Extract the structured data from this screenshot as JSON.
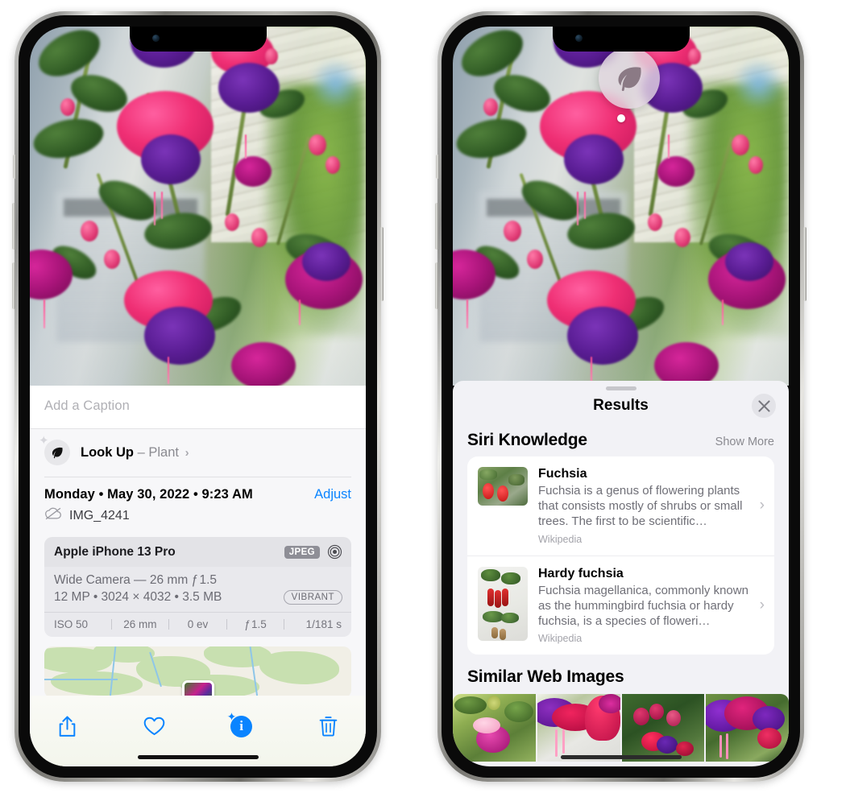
{
  "left_phone": {
    "caption": {
      "placeholder": "Add a Caption",
      "value": ""
    },
    "look_up": {
      "label": "Look Up",
      "dash": "–",
      "subject": "Plant",
      "chevron": "›",
      "icon": "leaf-icon",
      "sparkle": "✦"
    },
    "metadata": {
      "date_line": "Monday • May 30, 2022 • 9:23 AM",
      "adjust_label": "Adjust",
      "filename": "IMG_4241",
      "cloud_icon": "icloud-slash-icon"
    },
    "camera_card": {
      "model": "Apple iPhone 13 Pro",
      "format_chip": "JPEG",
      "raw_icon": "raw-circle-icon",
      "lens_line": "Wide Camera — 26 mm ƒ 1.5",
      "specs_line": "12 MP • 3024 × 4032 • 3.5 MB",
      "style_chip": "VIBRANT",
      "exif": [
        {
          "name": "iso",
          "value": "ISO 50"
        },
        {
          "name": "focal-length",
          "value": "26 mm"
        },
        {
          "name": "exposure-bias",
          "value": "0 ev"
        },
        {
          "name": "aperture",
          "value": "ƒ 1.5"
        },
        {
          "name": "shutter-speed",
          "value": "1/181 s"
        }
      ]
    },
    "toolbar": [
      {
        "name": "share-button",
        "icon": "share-icon"
      },
      {
        "name": "favorite-button",
        "icon": "heart-icon"
      },
      {
        "name": "info-button",
        "icon": "info-sparkle-icon",
        "glyph": "i"
      },
      {
        "name": "delete-button",
        "icon": "trash-icon"
      }
    ]
  },
  "right_phone": {
    "lookup_badge": {
      "icon": "leaf-icon"
    },
    "sheet": {
      "title": "Results",
      "close_icon": "close-icon"
    },
    "siri_knowledge": {
      "heading": "Siri Knowledge",
      "action": "Show More",
      "items": [
        {
          "title": "Fuchsia",
          "description": "Fuchsia is a genus of flowering plants that consists mostly of shrubs or small trees. The first to be scientific…",
          "source": "Wikipedia",
          "chevron": "›"
        },
        {
          "title": "Hardy fuchsia",
          "description": "Fuchsia magellanica, commonly known as the hummingbird fuchsia or hardy fuchsia, is a species of floweri…",
          "source": "Wikipedia",
          "chevron": "›"
        }
      ]
    },
    "similar_web_images": {
      "heading": "Similar Web Images",
      "thumbnails": [
        {
          "name": "web-image-1"
        },
        {
          "name": "web-image-2"
        },
        {
          "name": "web-image-3"
        },
        {
          "name": "web-image-4"
        }
      ]
    }
  },
  "colors": {
    "accent_blue": "#0a84ff",
    "sheet_bg": "#f2f2f6",
    "card_bg": "#ffffff",
    "muted_text": "#8a8a90"
  }
}
